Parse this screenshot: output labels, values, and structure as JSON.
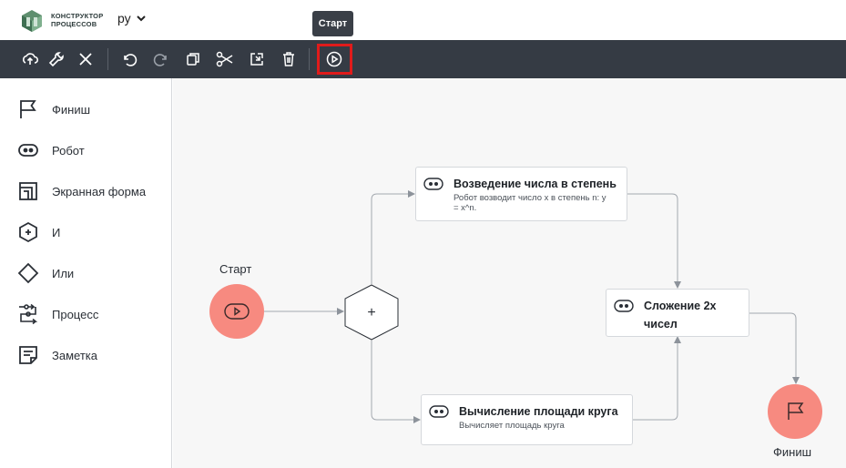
{
  "header": {
    "logo_line1": "КОНСТРУКТОР",
    "logo_line2": "ПРОЦЕССОВ",
    "language": "ру",
    "tooltip": "Старт"
  },
  "toolbar": {
    "buttons": [
      {
        "name": "cloud-upload-icon"
      },
      {
        "name": "wrench-icon"
      },
      {
        "name": "close-icon"
      },
      {
        "name": "undo-icon"
      },
      {
        "name": "redo-icon"
      },
      {
        "name": "copy-icon"
      },
      {
        "name": "scissors-icon"
      },
      {
        "name": "paste-icon"
      },
      {
        "name": "trash-icon"
      },
      {
        "name": "play-icon"
      }
    ]
  },
  "sidebar": {
    "items": [
      {
        "label": "Финиш",
        "icon": "flag-icon"
      },
      {
        "label": "Робот",
        "icon": "robot-icon"
      },
      {
        "label": "Экранная форма",
        "icon": "screen-form-icon"
      },
      {
        "label": "И",
        "icon": "and-gate-icon"
      },
      {
        "label": "Или",
        "icon": "or-gate-icon"
      },
      {
        "label": "Процесс",
        "icon": "process-icon"
      },
      {
        "label": "Заметка",
        "icon": "note-icon"
      }
    ]
  },
  "canvas": {
    "start_label": "Старт",
    "finish_label": "Финиш",
    "gate_symbol": "+",
    "cards": [
      {
        "title": "Возведение числа в степень",
        "desc_line1": "Робот возводит число x в степень n: y",
        "desc_line2": "= x^n."
      },
      {
        "title": "Вычисление площади круга",
        "desc_line1": "Вычисляет площадь круга",
        "desc_line2": ""
      },
      {
        "title_line1": "Сложение 2х",
        "title_line2": "чисел"
      }
    ]
  },
  "colors": {
    "toolbar_bg": "#353b44",
    "node_fill": "#f78a80",
    "highlight": "#e01b1b"
  }
}
